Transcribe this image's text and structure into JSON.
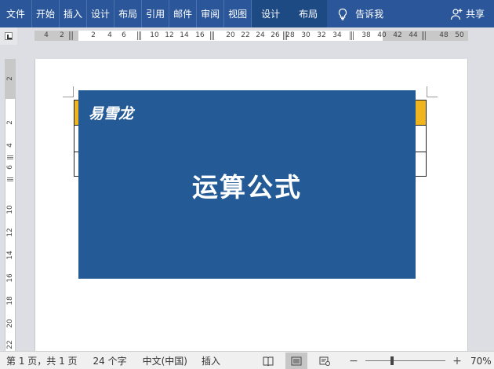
{
  "ribbon": {
    "tabs": [
      "文件",
      "开始",
      "插入",
      "设计",
      "布局",
      "引用",
      "邮件",
      "审阅",
      "视图"
    ],
    "context_tabs": [
      "设计",
      "布局"
    ],
    "tell_me": "告诉我",
    "share": "共享",
    "accent": "#2b579a"
  },
  "hruler": {
    "ticks": [
      "4",
      "2",
      "2",
      "4",
      "6",
      "8",
      "10",
      "12",
      "14",
      "16",
      "18",
      "20",
      "22",
      "24",
      "26",
      "28",
      "30",
      "32",
      "34",
      "36",
      "38",
      "40",
      "42",
      "44",
      "46",
      "48",
      "50"
    ]
  },
  "vruler": {
    "ticks": [
      "2",
      "2",
      "4",
      "6",
      "8",
      "10",
      "12",
      "14",
      "16",
      "18",
      "20",
      "22"
    ]
  },
  "document": {
    "brand": "易雪龙",
    "headline": "运算公式",
    "banner_color": "#245b96",
    "table_header_color": "#f0b41c"
  },
  "status": {
    "page": "第 1 页，共 1 页",
    "words": "24 个字",
    "language": "中文(中国)",
    "mode": "插入",
    "zoom_value": 70,
    "zoom_label": "70%",
    "zoom_minus": "−",
    "zoom_plus": "+"
  },
  "icons": [
    "lightbulb-icon",
    "person-add-icon",
    "read-mode-icon",
    "print-layout-icon",
    "web-layout-icon",
    "tab-stop-icon"
  ]
}
